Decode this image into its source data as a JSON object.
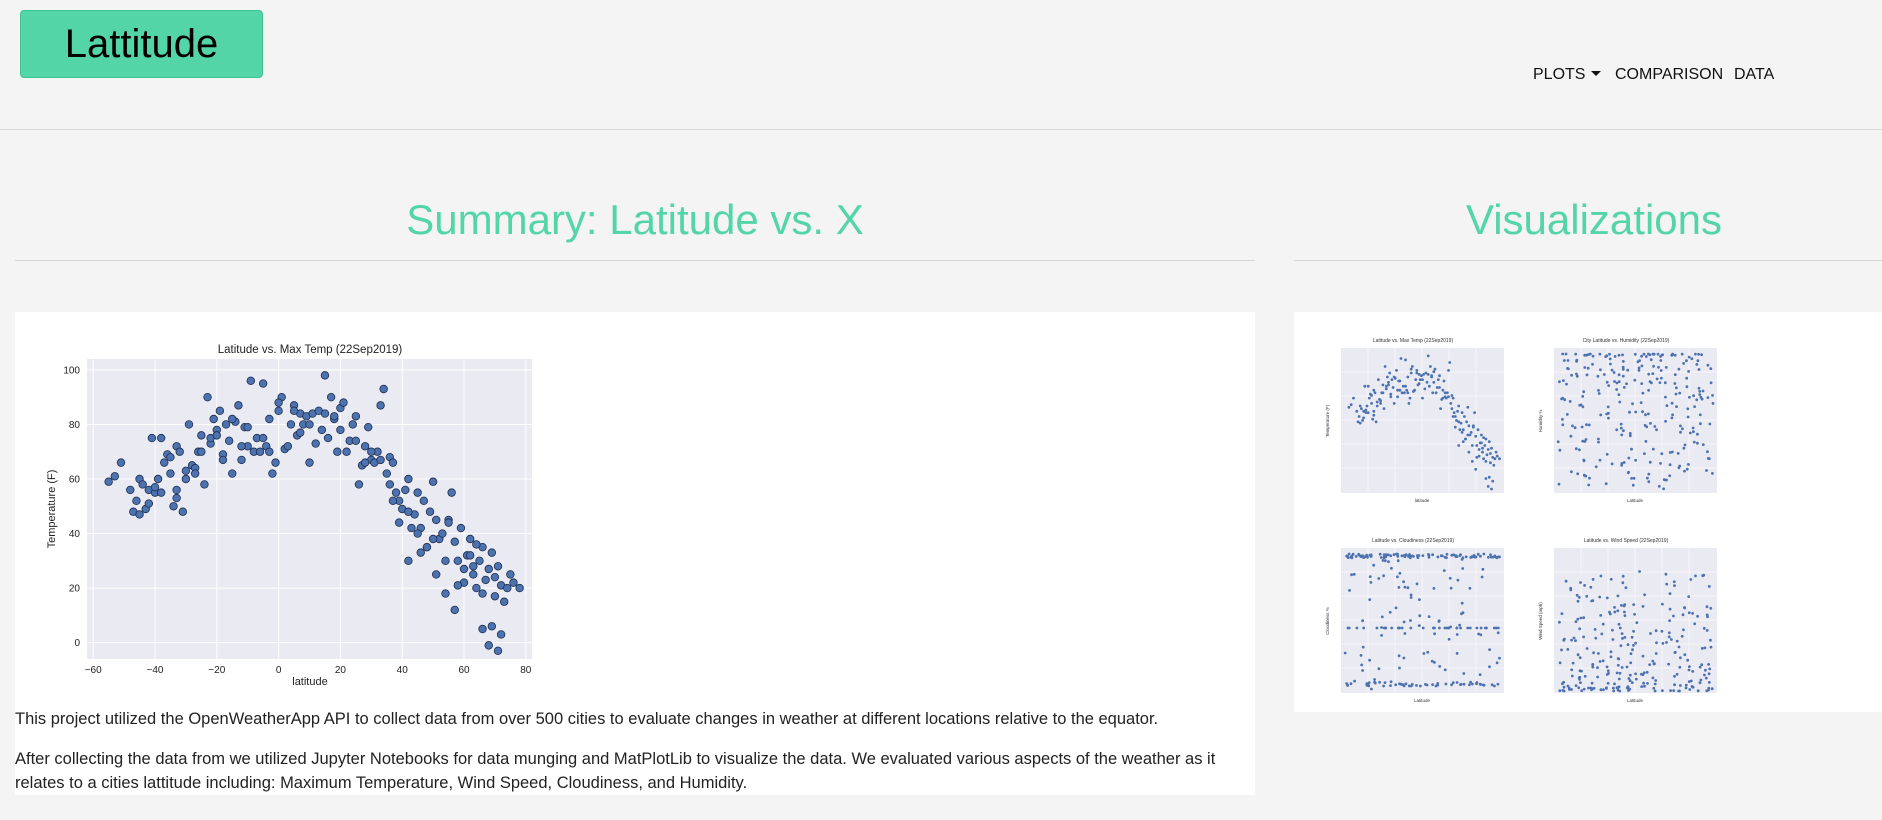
{
  "navbar": {
    "brand": "Lattitude",
    "items": [
      {
        "label": "PLOTS",
        "has_dropdown": true
      },
      {
        "label": "COMPARISON"
      },
      {
        "label": "DATA"
      }
    ]
  },
  "summary": {
    "heading": "Summary: Latitude vs. X",
    "paragraphs": [
      "This project utilized the OpenWeatherApp API to collect data from over 500 cities to evaluate changes in weather at different locations relative to the equator.",
      "After collecting the data from we utilized Jupyter Notebooks for data munging and MatPlotLib to visualize the data. We evaluated various aspects of the weather as it relates to a cities lattitude including: Maximum Temperature, Wind Speed, Cloudiness, and Humidity."
    ]
  },
  "visualizations": {
    "heading": "Visualizations",
    "thumbnails": [
      {
        "title": "Latitude vs. Max Temp (22Sep2019)",
        "xlabel": "latitude",
        "ylabel": "Temperature (F)"
      },
      {
        "title": "City Latitude vs. Humidity (22Sep2019)",
        "xlabel": "Latitude",
        "ylabel": "Humidity %"
      },
      {
        "title": "Latitude vs. Cloudiness (22Sep2019)",
        "xlabel": "Latitude",
        "ylabel": "Cloudiness %"
      },
      {
        "title": "Latitude vs. Wind Speed (22Sep2019)",
        "xlabel": "Latitude",
        "ylabel": "Wind Speed (mph)"
      }
    ]
  },
  "colors": {
    "accent": "#53d5a8",
    "point": "#4c72b0",
    "plot_bg": "#eaeaf2"
  },
  "chart_data": {
    "type": "scatter",
    "title": "Latitude vs. Max Temp (22Sep2019)",
    "xlabel": "latitude",
    "ylabel": "Temperature (F)",
    "xlim": [
      -62,
      82
    ],
    "ylim": [
      -6,
      104
    ],
    "xticks": [
      -60,
      -40,
      -20,
      0,
      20,
      40,
      60,
      80
    ],
    "yticks": [
      0,
      20,
      40,
      60,
      80,
      100
    ],
    "grid": true,
    "x": [
      -55,
      -53,
      -51,
      -48,
      -47,
      -46,
      -45,
      -44,
      -43,
      -42,
      -41,
      -40,
      -39,
      -38,
      -37,
      -36,
      -35,
      -34,
      -33,
      -33,
      -32,
      -31,
      -30,
      -29,
      -28,
      -27,
      -26,
      -25,
      -24,
      -23,
      -22,
      -21,
      -20,
      -19,
      -18,
      -17,
      -16,
      -15,
      -14,
      -13,
      -12,
      -11,
      -10,
      -9,
      -8,
      -7,
      -6,
      -5,
      -4,
      -3,
      -2,
      -1,
      0,
      1,
      2,
      3,
      4,
      5,
      6,
      7,
      8,
      9,
      10,
      11,
      12,
      13,
      14,
      15,
      16,
      17,
      18,
      19,
      20,
      21,
      22,
      23,
      24,
      25,
      26,
      27,
      28,
      29,
      30,
      31,
      32,
      33,
      34,
      35,
      36,
      37,
      38,
      39,
      40,
      41,
      42,
      43,
      44,
      45,
      46,
      47,
      48,
      49,
      50,
      51,
      52,
      53,
      54,
      55,
      56,
      57,
      58,
      59,
      60,
      61,
      62,
      63,
      64,
      65,
      66,
      67,
      68,
      69,
      70,
      71,
      72,
      73,
      74,
      75,
      76,
      78,
      -45,
      -42,
      -38,
      -35,
      -30,
      -25,
      -22,
      -18,
      -15,
      -10,
      -5,
      0,
      5,
      10,
      15,
      20,
      25,
      30,
      33,
      36,
      39,
      42,
      45,
      48,
      51,
      54,
      57,
      60,
      63,
      66,
      69,
      72,
      -40,
      -33,
      -27,
      -20,
      -12,
      -3,
      7,
      18,
      28,
      37,
      46,
      55,
      64,
      70,
      42,
      50,
      58,
      62,
      66,
      68,
      71
    ],
    "y": [
      59,
      61,
      66,
      56,
      48,
      52,
      60,
      58,
      49,
      56,
      75,
      55,
      60,
      75,
      66,
      69,
      62,
      50,
      72,
      56,
      70,
      48,
      63,
      80,
      65,
      64,
      70,
      76,
      58,
      90,
      73,
      82,
      78,
      85,
      69,
      80,
      74,
      62,
      81,
      87,
      67,
      79,
      72,
      96,
      70,
      75,
      70,
      95,
      72,
      82,
      62,
      66,
      85,
      90,
      71,
      72,
      80,
      87,
      76,
      84,
      80,
      83,
      66,
      84,
      73,
      85,
      78,
      98,
      75,
      90,
      82,
      70,
      86,
      88,
      70,
      74,
      80,
      83,
      58,
      65,
      72,
      79,
      67,
      66,
      70,
      87,
      93,
      62,
      68,
      66,
      55,
      52,
      49,
      56,
      60,
      42,
      47,
      55,
      42,
      52,
      35,
      48,
      59,
      45,
      38,
      40,
      30,
      45,
      55,
      37,
      30,
      42,
      27,
      32,
      38,
      25,
      20,
      30,
      35,
      23,
      27,
      33,
      17,
      28,
      21,
      15,
      20,
      25,
      22,
      20,
      47,
      51,
      55,
      68,
      60,
      70,
      75,
      67,
      82,
      79,
      75,
      88,
      85,
      80,
      84,
      78,
      74,
      70,
      67,
      58,
      44,
      30,
      40,
      35,
      25,
      18,
      12,
      22,
      28,
      18,
      6,
      3,
      57,
      53,
      62,
      76,
      72,
      70,
      77,
      83,
      66,
      52,
      33,
      44,
      36,
      24,
      48,
      38,
      21,
      32,
      5,
      -1,
      -3
    ]
  }
}
